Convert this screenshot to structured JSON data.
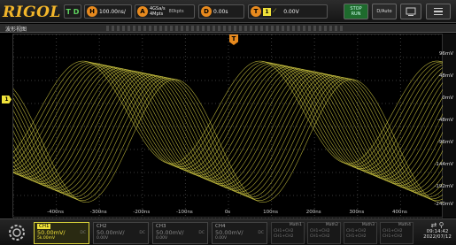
{
  "header": {
    "logo": "RIGOL",
    "run_mode": "T D",
    "horizontal_badge": "H",
    "timebase": "100.00ns/",
    "acquire_badge": "A",
    "sample_rate": "4GSa/s",
    "memory_depth": "4Mpts",
    "acq_rate": "80kpts",
    "delay_badge": "D",
    "delay": "0.00s",
    "trigger_badge": "T",
    "trigger_source": "1",
    "trigger_level": "0.00V",
    "run_stop_label": "STOP\nRUN",
    "auto_label": "D/Auto"
  },
  "window": {
    "title": "波形视图"
  },
  "markers": {
    "trigger_marker": "T",
    "ch1_marker": "1"
  },
  "vertical_labels": [
    "96mV",
    "48mV",
    "0mV",
    "-48mV",
    "-96mV",
    "-144mV",
    "-192mV",
    "-240mV"
  ],
  "horizontal_labels": [
    "-400ns",
    "-300ns",
    "-200ns",
    "-100ns",
    "0s",
    "100ns",
    "200ns",
    "300ns",
    "400ns"
  ],
  "channels": [
    {
      "name": "CH1",
      "scale": "50.00mV/",
      "offset": "5k.00mV",
      "coupling": "DC",
      "active": true
    },
    {
      "name": "CH2",
      "scale": "50.00mV/",
      "offset": "0.00V",
      "coupling": "DC",
      "active": false
    },
    {
      "name": "CH3",
      "scale": "50.00mV/",
      "offset": "0.00V",
      "coupling": "DC",
      "active": false
    },
    {
      "name": "CH4",
      "scale": "50.00mV/",
      "offset": "0.00V",
      "coupling": "DC",
      "active": false
    }
  ],
  "math": [
    {
      "name": "Math1",
      "line1": "CH1+CH2",
      "line2": "CH1+CH2"
    },
    {
      "name": "Math2",
      "line1": "CH1+CH2",
      "line2": "CH1+CH2"
    },
    {
      "name": "Math3",
      "line1": "CH1+CH2",
      "line2": "CH1+CH2"
    },
    {
      "name": "Math4",
      "line1": "CH1+CH2",
      "line2": "CH1+CH2"
    }
  ],
  "status": {
    "icons": "⇄ ⚲",
    "time": "09:14:42",
    "date": "2022/07/12"
  },
  "colors": {
    "trace": "#e9e24a",
    "trigger_accent": "#e88a1e",
    "run_green": "#1e6b2d"
  }
}
